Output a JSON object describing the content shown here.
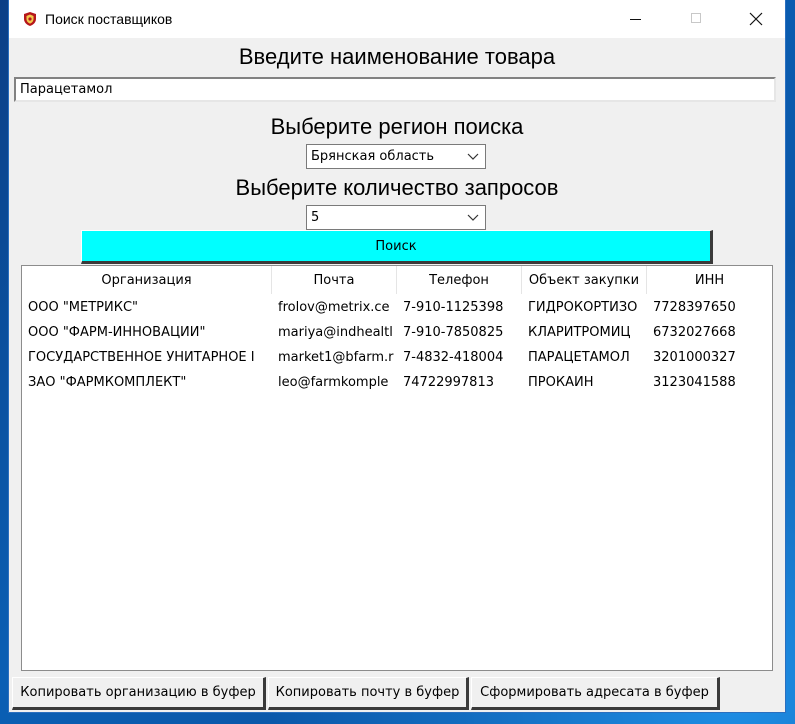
{
  "window": {
    "title": "Поиск поставщиков"
  },
  "form": {
    "product_heading": "Введите наименование товара",
    "product_value": "Парацетамол",
    "region_heading": "Выберите регион поиска",
    "region_value": "Брянская область",
    "count_heading": "Выберите количество запросов",
    "count_value": "5",
    "search_label": "Поиск",
    "search_color": "#00ffff"
  },
  "table": {
    "columns": [
      "Организация",
      "Почта",
      "Телефон",
      "Объект закупки",
      "ИНН"
    ],
    "rows": [
      [
        "ООО \"МЕТРИКС\"",
        "frolov@metrix.ce",
        "7-910-1125398",
        "ГИДРОКОРТИЗО",
        "7728397650"
      ],
      [
        "ООО \"ФАРМ-ИННОВАЦИИ\"",
        "mariya@indhealtl",
        "7-910-7850825",
        "КЛАРИТРОМИЦ",
        "6732027668"
      ],
      [
        "ГОСУДАРСТВЕННОЕ УНИТАРНОЕ I",
        "market1@bfarm.r",
        "7-4832-418004",
        "ПАРАЦЕТАМОЛ",
        "3201000327"
      ],
      [
        "ЗАО \"ФАРМКОМПЛЕКТ\"",
        "leo@farmkomple",
        "74722997813",
        "ПРОКАИН",
        "3123041588"
      ]
    ]
  },
  "buttons": {
    "copy_org": "Копировать организацию в буфер",
    "copy_mail": "Копировать почту в буфер",
    "make_addressee": "Сформировать адресата в буфер"
  }
}
